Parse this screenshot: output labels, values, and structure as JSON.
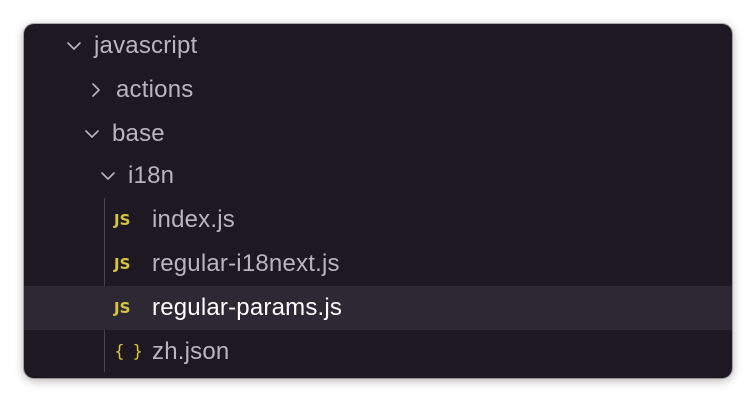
{
  "explorer": {
    "tree": [
      {
        "label": "javascript",
        "kind": "folder",
        "expanded": true,
        "depth": 0
      },
      {
        "label": "actions",
        "kind": "folder",
        "expanded": false,
        "depth": 1
      },
      {
        "label": "base",
        "kind": "folder",
        "expanded": true,
        "depth": 1
      },
      {
        "label": "i18n",
        "kind": "folder",
        "expanded": true,
        "depth": 2
      },
      {
        "label": "index.js",
        "kind": "file",
        "icon": "JS",
        "icon_name": "javascript-file-icon",
        "depth": 3
      },
      {
        "label": "regular-i18next.js",
        "kind": "file",
        "icon": "JS",
        "icon_name": "javascript-file-icon",
        "depth": 3
      },
      {
        "label": "regular-params.js",
        "kind": "file",
        "icon": "JS",
        "icon_name": "javascript-file-icon",
        "depth": 3,
        "selected": true
      },
      {
        "label": "zh.json",
        "kind": "file",
        "icon": "{ }",
        "icon_name": "json-file-icon",
        "depth": 3
      }
    ]
  },
  "colors": {
    "panel_background": "#1d1822",
    "selected_row": "#2e2835",
    "text": "#b9b5bf",
    "selected_text": "#ffffff",
    "js_icon": "#d6c43b"
  }
}
